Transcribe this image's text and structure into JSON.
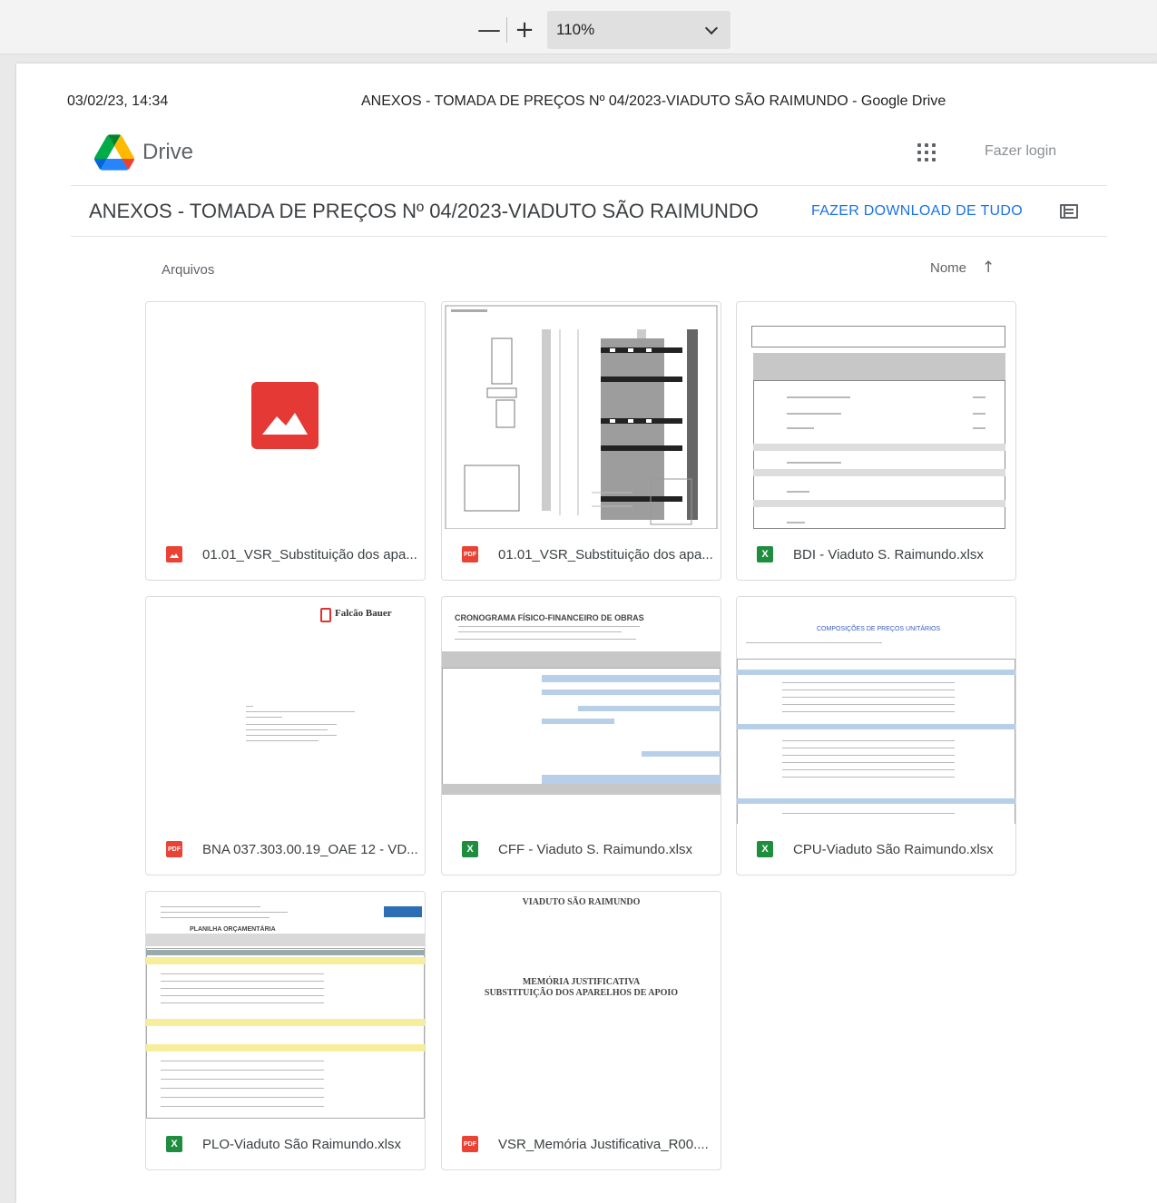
{
  "viewer": {
    "zoom_out": "—",
    "zoom_in": "+",
    "zoom_level": "110%"
  },
  "print_header": {
    "date": "03/02/23, 14:34",
    "title": "ANEXOS - TOMADA DE PREÇOS Nº 04/2023-VIADUTO SÃO RAIMUNDO - Google Drive"
  },
  "app": {
    "name": "Drive",
    "login": "Fazer login"
  },
  "folder": {
    "title": "ANEXOS - TOMADA DE PREÇOS Nº 04/2023-VIADUTO SÃO RAIMUNDO",
    "download_all": "FAZER DOWNLOAD DE TUDO"
  },
  "files_section": {
    "label": "Arquivos",
    "sort_by": "Nome",
    "sort_arrow": "↑"
  },
  "thumb_text": {
    "falcao": "Falcão Bauer",
    "cronograma": "CRONOGRAMA FÍSICO-FINANCEIRO DE OBRAS",
    "composicoes": "COMPOSIÇÕES DE PREÇOS UNITÁRIOS",
    "planilha": "PLANILHA ORÇAMENTÁRIA",
    "viaduto": "VIADUTO SÃO RAIMUNDO",
    "memoria_1": "MEMÓRIA JUSTIFICATIVA",
    "memoria_2": "SUBSTITUIÇÃO DOS APARELHOS DE APOIO"
  },
  "files": [
    {
      "name": "01.01_VSR_Substituição dos apa...",
      "type": "img",
      "type_label": ""
    },
    {
      "name": "01.01_VSR_Substituição dos apa...",
      "type": "pdf",
      "type_label": "PDF"
    },
    {
      "name": "BDI - Viaduto S. Raimundo.xlsx",
      "type": "xls",
      "type_label": "X"
    },
    {
      "name": "BNA 037.303.00.19_OAE 12 - VD...",
      "type": "pdf",
      "type_label": "PDF"
    },
    {
      "name": "CFF - Viaduto S. Raimundo.xlsx",
      "type": "xls",
      "type_label": "X"
    },
    {
      "name": "CPU-Viaduto São Raimundo.xlsx",
      "type": "xls",
      "type_label": "X"
    },
    {
      "name": "PLO-Viaduto São Raimundo.xlsx",
      "type": "xls",
      "type_label": "X"
    },
    {
      "name": "VSR_Memória Justificativa_R00....",
      "type": "pdf",
      "type_label": "PDF"
    }
  ]
}
